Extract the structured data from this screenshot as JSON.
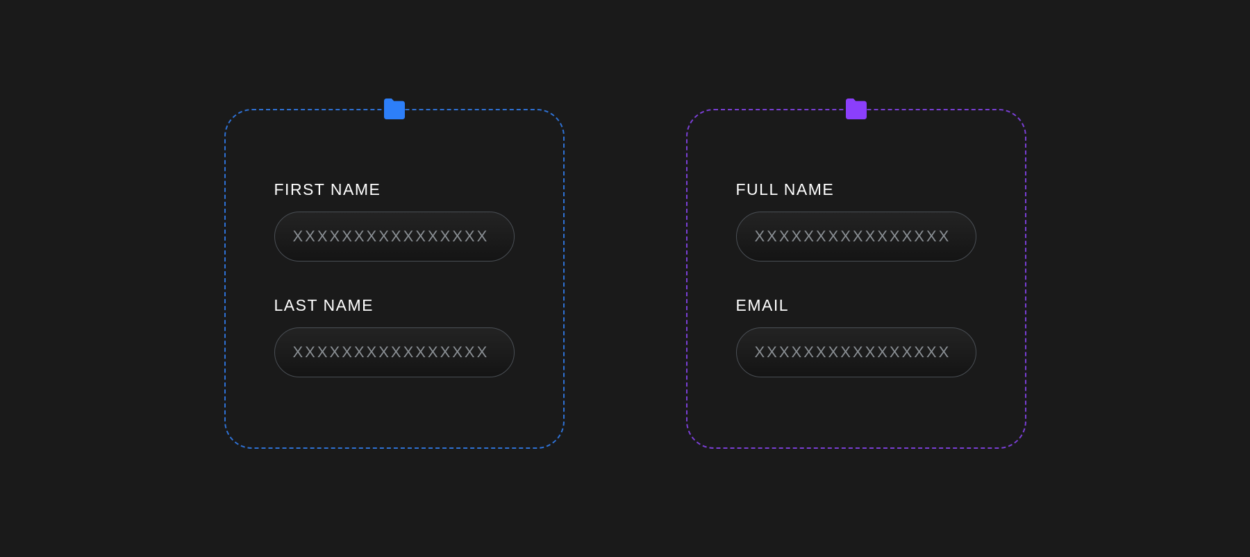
{
  "colors": {
    "blue": "#2d7ff9",
    "purple": "#8b3ffb"
  },
  "cards": {
    "left": {
      "icon": "folder-icon",
      "accent": "blue",
      "fields": [
        {
          "label": "FIRST NAME",
          "placeholder": "XXXXXXXXXXXXXXXX"
        },
        {
          "label": "LAST NAME",
          "placeholder": "XXXXXXXXXXXXXXXX"
        }
      ]
    },
    "right": {
      "icon": "folder-icon",
      "accent": "purple",
      "fields": [
        {
          "label": "FULL NAME",
          "placeholder": "XXXXXXXXXXXXXXXX"
        },
        {
          "label": "EMAIL",
          "placeholder": "XXXXXXXXXXXXXXXX"
        }
      ]
    }
  }
}
